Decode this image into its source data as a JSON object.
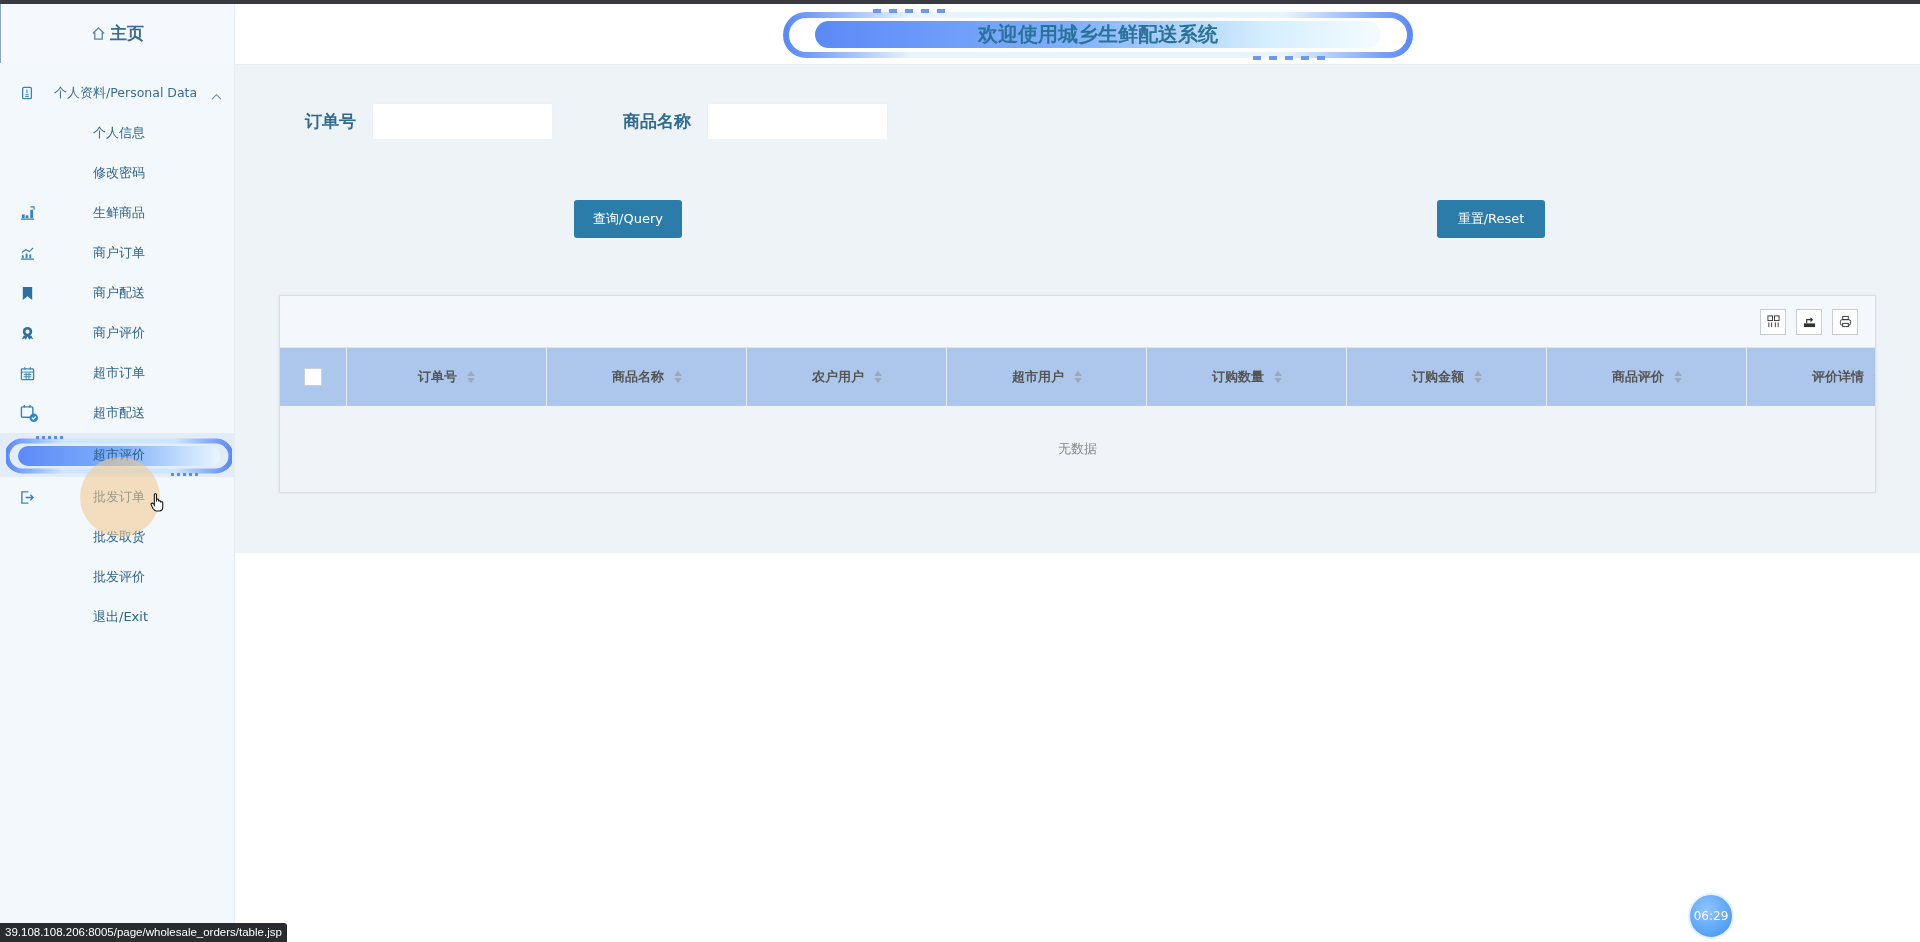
{
  "sidebar": {
    "home": "主页",
    "items": [
      {
        "kind": "group",
        "label": "个人资料/Personal Data",
        "expanded": true,
        "children": [
          {
            "label": "个人信息",
            "selected": false
          },
          {
            "label": "修改密码",
            "selected": false
          }
        ]
      },
      {
        "kind": "item",
        "label": "生鲜商品",
        "selected": false
      },
      {
        "kind": "item",
        "label": "商户订单",
        "selected": false
      },
      {
        "kind": "item",
        "label": "商户配送",
        "selected": false
      },
      {
        "kind": "item",
        "label": "商户评价",
        "selected": false
      },
      {
        "kind": "item",
        "label": "超市订单",
        "selected": false
      },
      {
        "kind": "item",
        "label": "超市配送",
        "selected": false
      },
      {
        "kind": "item",
        "label": "超市评价",
        "selected": true
      },
      {
        "kind": "item",
        "label": "批发订单",
        "selected": false
      },
      {
        "kind": "item",
        "label": "批发取货",
        "selected": false
      },
      {
        "kind": "item",
        "label": "批发评价",
        "selected": false
      },
      {
        "kind": "item",
        "label": "退出/Exit",
        "selected": false
      }
    ]
  },
  "header": {
    "title": "欢迎使用城乡生鲜配送系统"
  },
  "search": {
    "fields": [
      {
        "label": "订单号"
      },
      {
        "label": "商品名称"
      }
    ],
    "buttons": [
      "查询/Query",
      "重置/Reset"
    ]
  },
  "table": {
    "select_all": false,
    "columns": [
      "订单号",
      "商品名称",
      "农户用户",
      "超市用户",
      "订购数量",
      "订购金额",
      "商品评价",
      "评价详情"
    ],
    "empty_text": "无数据"
  },
  "status_bar": {
    "url": "39.108.108.206:8005/page/wholesale_orders/table.jsp"
  },
  "clock": "06:29"
}
